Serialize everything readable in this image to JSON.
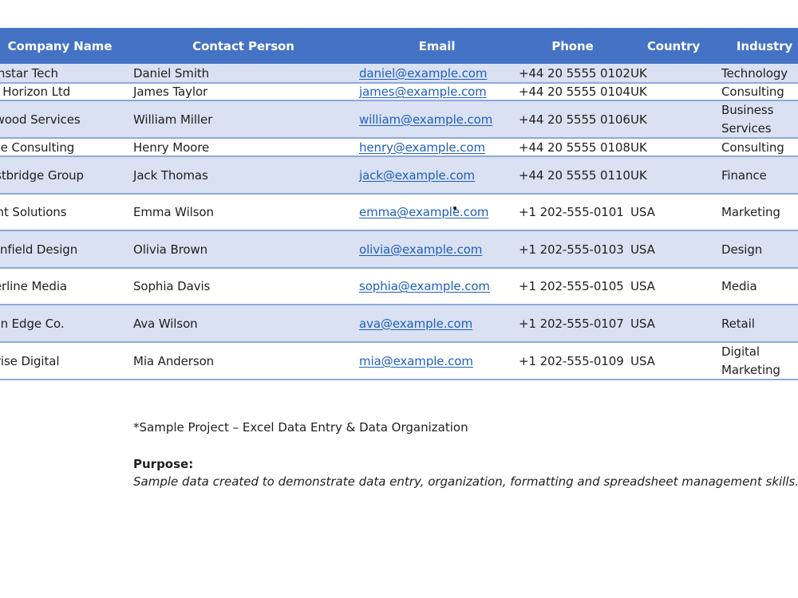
{
  "table": {
    "headers": {
      "company": "Company Name",
      "contact": "Contact Person",
      "email": "Email",
      "phone": "Phone",
      "country": "Country",
      "industry": "Industry"
    },
    "rows": [
      {
        "company": "orthstar Tech",
        "contact": "Daniel Smith",
        "email": "daniel@example.com",
        "phone": "+44 20 5555 0102",
        "country": "UK",
        "industry": "Technology"
      },
      {
        "company": "lue Horizon Ltd",
        "contact": "James Taylor",
        "email": "james@example.com",
        "phone": "+44 20 5555 0104",
        "country": "UK",
        "industry": "Consulting"
      },
      {
        "company": "akwood Services",
        "contact": "William Miller",
        "email": "william@example.com",
        "phone": "+44 20 5555 0106",
        "country": "UK",
        "industry": "Business Services"
      },
      {
        "company": "rime Consulting",
        "contact": "Henry Moore",
        "email": "henry@example.com",
        "phone": "+44 20 5555 0108",
        "country": "UK",
        "industry": "Consulting"
      },
      {
        "company": "Vestbridge Group",
        "contact": "Jack Thomas",
        "email": "jack@example.com",
        "phone": "+44 20 5555 0110",
        "country": "UK",
        "industry": "Finance"
      },
      {
        "company": "right Solutions",
        "contact": "Emma Wilson",
        "email": "emma@example.com",
        "phone": "+1 202-555-0101",
        "country": "USA",
        "industry": "Marketing"
      },
      {
        "company": "reenfield Design",
        "contact": "Olivia Brown",
        "email": "olivia@example.com",
        "phone": "+1 202-555-0103",
        "country": "USA",
        "industry": "Design"
      },
      {
        "company": "ilverline Media",
        "contact": "Sophia Davis",
        "email": "sophia@example.com",
        "phone": "+1 202-555-0105",
        "country": "USA",
        "industry": "Media"
      },
      {
        "company": "rban Edge Co.",
        "contact": "Ava Wilson",
        "email": "ava@example.com",
        "phone": "+1 202-555-0107",
        "country": "USA",
        "industry": "Retail"
      },
      {
        "company": "unrise Digital",
        "contact": "Mia Anderson",
        "email": "mia@example.com",
        "phone": "+1 202-555-0109",
        "country": "USA",
        "industry": "Digital Marketing"
      }
    ]
  },
  "notes": {
    "title": "*Sample Project – Excel Data Entry & Data Organization",
    "purpose_label": "Purpose:",
    "purpose_text": "Sample data created to demonstrate data entry, organization, formatting and spreadsheet management skills."
  },
  "colors": {
    "header_bg": "#4472c4",
    "band_bg": "#d9e1f2",
    "row_border": "#8ea9db",
    "link": "#1f5fbf"
  }
}
